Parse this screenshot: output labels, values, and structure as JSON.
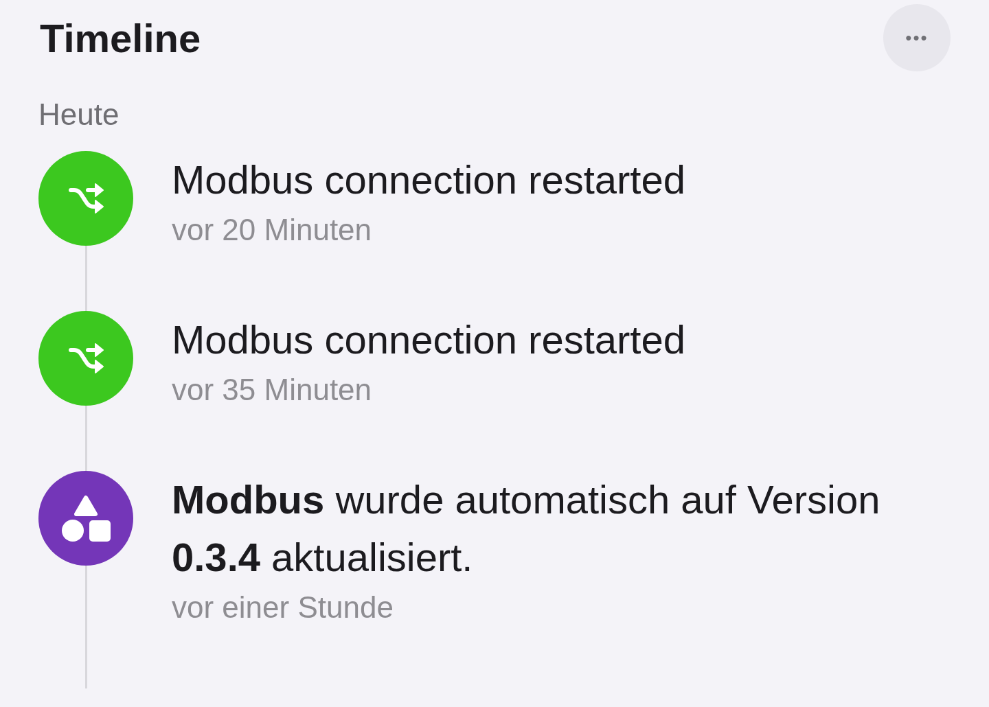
{
  "header": {
    "title": "Timeline",
    "menu_button": "•••"
  },
  "groups": [
    {
      "label": "Heute",
      "events": [
        {
          "kind": "connection",
          "color": "#3cc81f",
          "title": "Modbus connection restarted",
          "time": "vor 20 Minuten"
        },
        {
          "kind": "connection",
          "color": "#3cc81f",
          "title": "Modbus connection restarted",
          "time": "vor 35 Minuten"
        },
        {
          "kind": "update",
          "color": "#7436b8",
          "title": "**Modbus** wurde automatisch auf Version **0.3.4** aktualisiert.",
          "time": "vor einer Stunde"
        }
      ]
    }
  ]
}
